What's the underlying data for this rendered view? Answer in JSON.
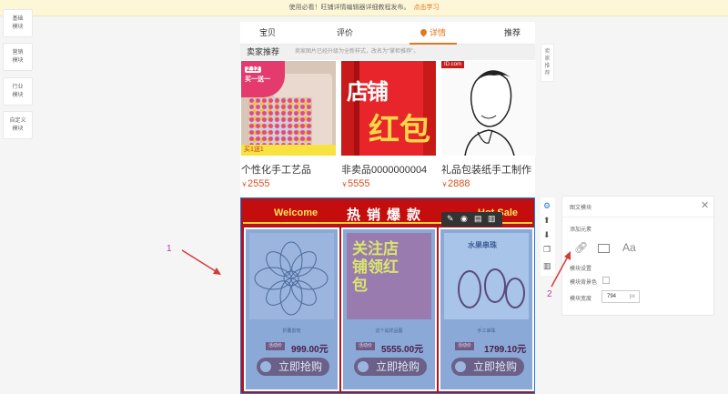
{
  "notice": {
    "text": "使用必看！旺铺详情编辑器详细教程发布。",
    "link": "点击学习"
  },
  "left_nav": [
    {
      "label": "基础\n模块"
    },
    {
      "label": "营销\n模块"
    },
    {
      "label": "行业\n模块"
    },
    {
      "label": "自定义\n模块"
    }
  ],
  "tabs": [
    {
      "label": "宝贝"
    },
    {
      "label": "评价"
    },
    {
      "label": "详情"
    },
    {
      "label": "推荐"
    }
  ],
  "section": {
    "title": "卖家推荐",
    "note": "卖家图片已经升级为全新样式，改名为\"掌柜推荐\"。"
  },
  "products": [
    {
      "name": "个性化手工艺品",
      "currency": "￥",
      "price": "2555",
      "img_text_1": "2.12",
      "img_text_2": "买一送一",
      "img_text_3": "买1送1",
      "img_text_4": "送"
    },
    {
      "name": "非卖品0000000004",
      "currency": "￥",
      "price": "5555",
      "img_text_1": "店铺",
      "img_text_2": "红包"
    },
    {
      "name": "礼品包装纸手工制作",
      "currency": "￥",
      "price": "2888",
      "img_text_1": "ID.com"
    }
  ],
  "banner": {
    "welcome": "Welcome",
    "hot": "热销爆款",
    "sale": "Hot Sale",
    "cards": [
      {
        "name": "折叠剪枝",
        "tag": "活动价",
        "price": "999.00元",
        "buy": "立即抢购"
      },
      {
        "name": "这个是样品图",
        "tag": "活动价",
        "price": "5555.00元",
        "buy": "立即抢购",
        "pic_text": "关注店铺领红包"
      },
      {
        "name": "手工串珠",
        "tag": "活动价",
        "price": "1799.10元",
        "buy": "立即抢购",
        "pic_text": "水果串珠"
      }
    ]
  },
  "right_tab": {
    "label": "卖\n家\n推\n荐"
  },
  "panel": {
    "title": "图文模块",
    "add_label": "添加元素",
    "text_icon": "Aa",
    "settings_label": "模块设置",
    "bg_label": "模块背景色",
    "width_label": "模块宽度",
    "width_value": "794",
    "width_unit": "px"
  },
  "annotations": {
    "one": "1",
    "two": "2"
  },
  "colors": {
    "accent": "#e0781e",
    "banner_red": "#b5121b",
    "price": "#d9501e",
    "annotation": "#b03fa8"
  }
}
